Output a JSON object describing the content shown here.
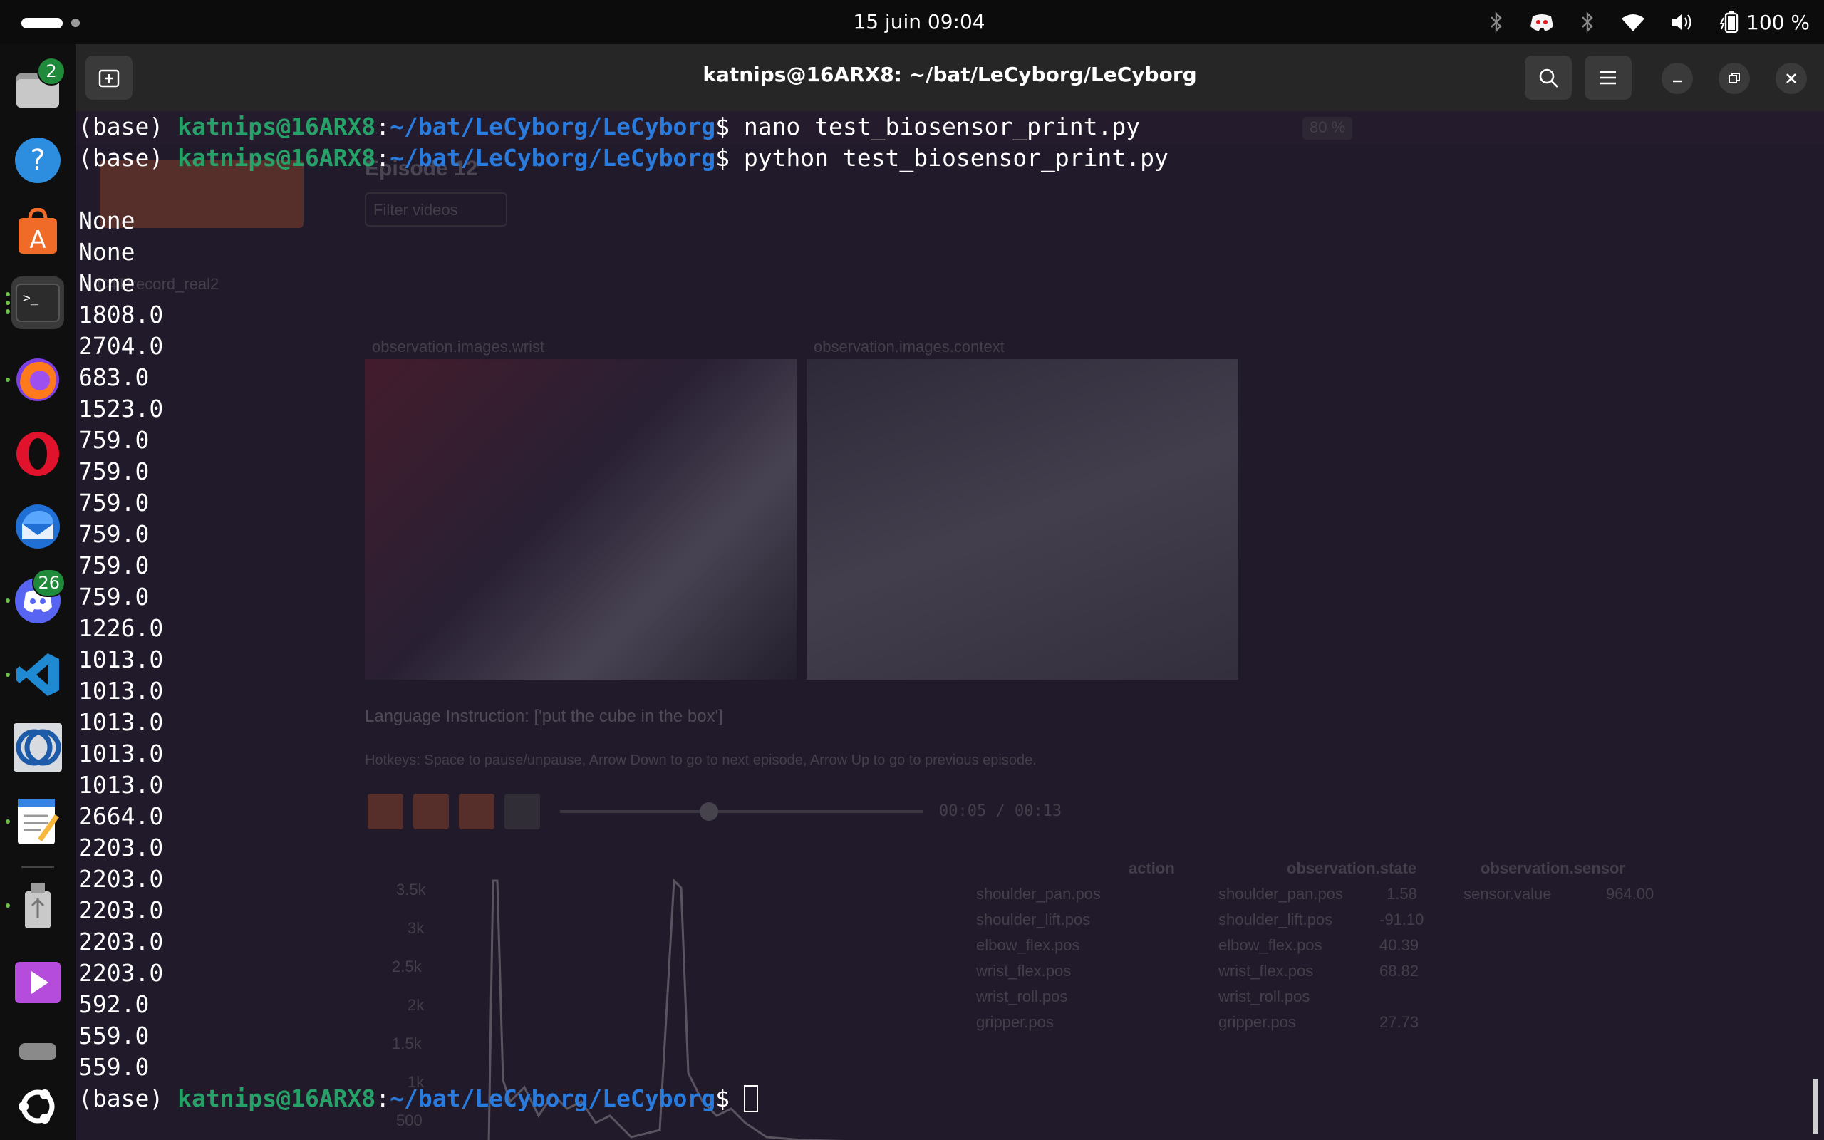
{
  "topbar": {
    "date_time": "15 juin  09:04",
    "battery": "100 %"
  },
  "dock": {
    "items": [
      {
        "name": "files",
        "badge": "2"
      },
      {
        "name": "help"
      },
      {
        "name": "app-center"
      },
      {
        "name": "terminal"
      },
      {
        "name": "firefox"
      },
      {
        "name": "opera"
      },
      {
        "name": "thunderbird"
      },
      {
        "name": "discord",
        "badge": "26"
      },
      {
        "name": "vscode"
      },
      {
        "name": "cura"
      },
      {
        "name": "text-editor"
      },
      {
        "name": "usb-drive"
      },
      {
        "name": "media-player"
      },
      {
        "name": "trash"
      },
      {
        "name": "show-apps"
      }
    ]
  },
  "window": {
    "title": "katnips@16ARX8: ~/bat/LeCyborg/LeCyborg"
  },
  "terminal": {
    "prompt": {
      "env": "(base) ",
      "user": "katnips@16ARX8",
      "sep": ":",
      "path": "~/bat/LeCyborg/LeCyborg",
      "sym": "$ "
    },
    "commands": [
      "nano test_biosensor_print.py",
      "python test_biosensor_print.py"
    ],
    "output": [
      "",
      "None",
      "None",
      "None",
      "1808.0",
      "2704.0",
      "683.0",
      "1523.0",
      "759.0",
      "759.0",
      "759.0",
      "759.0",
      "759.0",
      "759.0",
      "1226.0",
      "1013.0",
      "1013.0",
      "1013.0",
      "1013.0",
      "1013.0",
      "2664.0",
      "2203.0",
      "2203.0",
      "2203.0",
      "2203.0",
      "2203.0",
      "592.0",
      "559.0",
      "559.0"
    ]
  },
  "background_window": {
    "zoom": "80 %",
    "episode_title": "Episode 12",
    "filter_placeholder": "Filter videos",
    "video_labels": [
      "observation.images.wrist",
      "observation.images.context"
    ],
    "repo": "C4T/record_real2",
    "language_instruction": "Language Instruction: ['put the cube in the box']",
    "hotkeys": "Hotkeys: Space to pause/unpause, Arrow Down to go to next episode, Arrow Up to go to previous episode.",
    "time": "00:05 / 00:13",
    "y_ticks": [
      "3.5k",
      "3k",
      "2.5k",
      "2k",
      "1.5k",
      "1k",
      "500"
    ],
    "table_headers": [
      "action",
      "observation.state",
      "observation.sensor"
    ],
    "rows": [
      "shoulder_pan.pos",
      "shoulder_lift.pos",
      "elbow_flex.pos",
      "wrist_flex.pos",
      "wrist_roll.pos",
      "gripper.pos"
    ],
    "state_values": [
      "1.58",
      "-91.10",
      "40.39",
      "68.82",
      "",
      "27.73"
    ],
    "sensor_label": "sensor.value",
    "sensor_value": "964.00"
  }
}
